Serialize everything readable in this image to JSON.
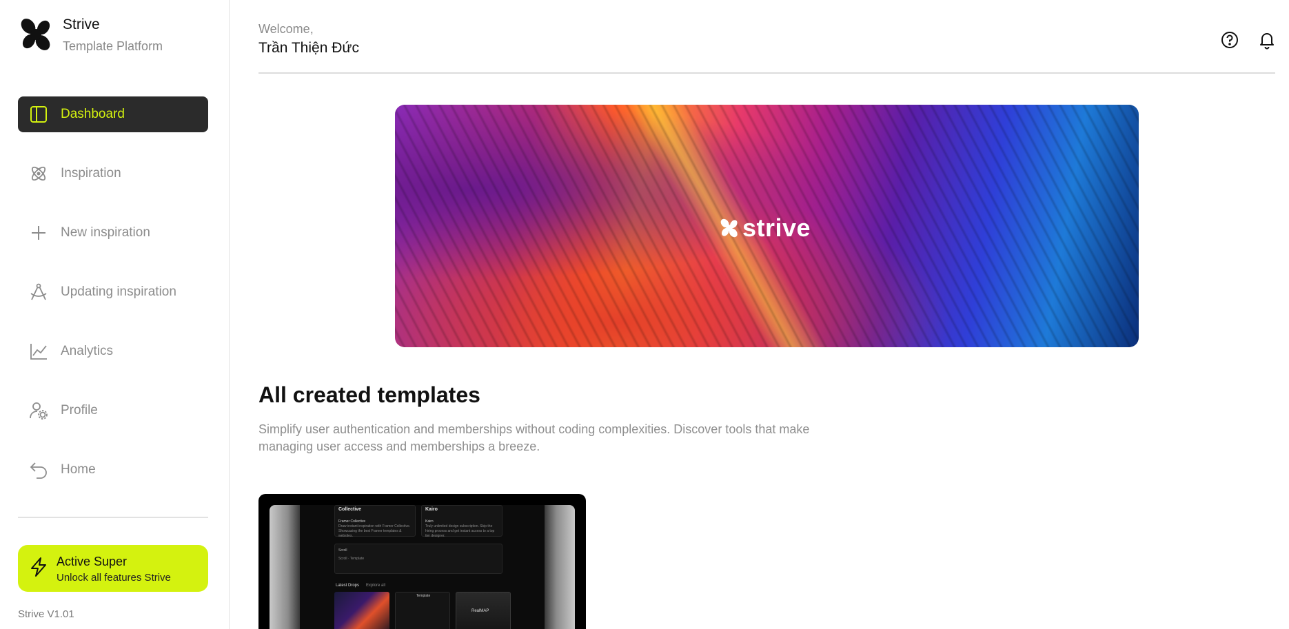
{
  "brand": {
    "name": "Strive",
    "subtitle": "Template Platform"
  },
  "sidebar": {
    "items": [
      {
        "label": "Dashboard",
        "icon": "sidebar-panel-icon",
        "active": true
      },
      {
        "label": "Inspiration",
        "icon": "atom-icon",
        "active": false
      },
      {
        "label": "New inspiration",
        "icon": "plus-icon",
        "active": false
      },
      {
        "label": "Updating inspiration",
        "icon": "compass-drafting-icon",
        "active": false
      },
      {
        "label": "Analytics",
        "icon": "line-chart-icon",
        "active": false
      },
      {
        "label": "Profile",
        "icon": "user-settings-icon",
        "active": false
      },
      {
        "label": "Home",
        "icon": "undo-arrow-icon",
        "active": false
      }
    ],
    "promo": {
      "title": "Active Super",
      "subtitle": "Unlock all features Strive",
      "icon": "lightning-icon"
    },
    "version": "Strive V1.01"
  },
  "header": {
    "welcome": "Welcome,",
    "user_name": "Trần Thiện Đức",
    "icons": [
      "help-icon",
      "bell-icon"
    ]
  },
  "hero": {
    "brand_text": "strive"
  },
  "section": {
    "title": "All created templates",
    "description": "Simplify user authentication and memberships without coding complexities. Discover tools that make managing user access and memberships a breeze."
  },
  "template_preview": {
    "cards": [
      {
        "title": "Collective",
        "heading": "Framer Collective",
        "text": "Draw instant inspiration with Framer Collective. Showcasing the best Framer templates & websites."
      },
      {
        "title": "Kairo",
        "heading": "Kairo",
        "text": "Truly unlimited design subscription. Skip the hiring process and get instant access to a top tier designer."
      }
    ],
    "scroll_label": "Scroll",
    "scroll_sub": "Scroll · Template",
    "latest_label": "Latest Drops",
    "explore_label": "Explore all",
    "thumb_labels": [
      "Template",
      "RealMAP"
    ]
  },
  "colors": {
    "accent": "#d4f20f",
    "active_bg": "#2b2b2b",
    "muted_text": "#8c8c8c"
  }
}
